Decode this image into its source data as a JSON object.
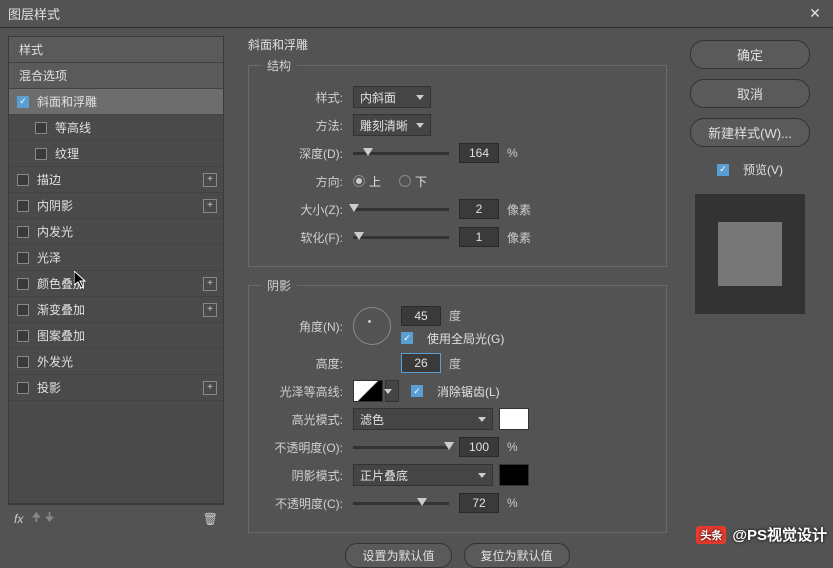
{
  "title": "图层样式",
  "sidebar": {
    "header_styles": "样式",
    "header_blend": "混合选项",
    "items": [
      {
        "label": "斜面和浮雕",
        "checked": true,
        "selected": true
      },
      {
        "label": "等高线",
        "checked": false,
        "sub": true
      },
      {
        "label": "纹理",
        "checked": false,
        "sub": true
      },
      {
        "label": "描边",
        "checked": false,
        "plus": true
      },
      {
        "label": "内阴影",
        "checked": false,
        "plus": true
      },
      {
        "label": "内发光",
        "checked": false
      },
      {
        "label": "光泽",
        "checked": false
      },
      {
        "label": "颜色叠加",
        "checked": false,
        "plus": true
      },
      {
        "label": "渐变叠加",
        "checked": false,
        "plus": true
      },
      {
        "label": "图案叠加",
        "checked": false
      },
      {
        "label": "外发光",
        "checked": false
      },
      {
        "label": "投影",
        "checked": false,
        "plus": true
      }
    ],
    "fx": "fx"
  },
  "panel": {
    "title": "斜面和浮雕",
    "structure": {
      "legend": "结构",
      "style_label": "样式:",
      "style_value": "内斜面",
      "method_label": "方法:",
      "method_value": "雕刻清晰",
      "depth_label": "深度(D):",
      "depth_value": "164",
      "depth_unit": "%",
      "direction_label": "方向:",
      "dir_up": "上",
      "dir_down": "下",
      "size_label": "大小(Z):",
      "size_value": "2",
      "size_unit": "像素",
      "soften_label": "软化(F):",
      "soften_value": "1",
      "soften_unit": "像素"
    },
    "shadow": {
      "legend": "阴影",
      "angle_label": "角度(N):",
      "angle_value": "45",
      "angle_unit": "度",
      "global_label": "使用全局光(G)",
      "altitude_label": "高度:",
      "altitude_value": "26",
      "altitude_unit": "度",
      "contour_label": "光泽等高线:",
      "antialias_label": "消除锯齿(L)",
      "hmode_label": "高光模式:",
      "hmode_value": "滤色",
      "hopacity_label": "不透明度(O):",
      "hopacity_value": "100",
      "hopacity_unit": "%",
      "smode_label": "阴影模式:",
      "smode_value": "正片叠底",
      "sopacity_label": "不透明度(C):",
      "sopacity_value": "72",
      "sopacity_unit": "%"
    },
    "btn_default": "设置为默认值",
    "btn_reset": "复位为默认值"
  },
  "right": {
    "ok": "确定",
    "cancel": "取消",
    "newstyle": "新建样式(W)...",
    "preview": "预览(V)"
  },
  "watermark": {
    "badge": "头条",
    "text": "@PS视觉设计"
  }
}
